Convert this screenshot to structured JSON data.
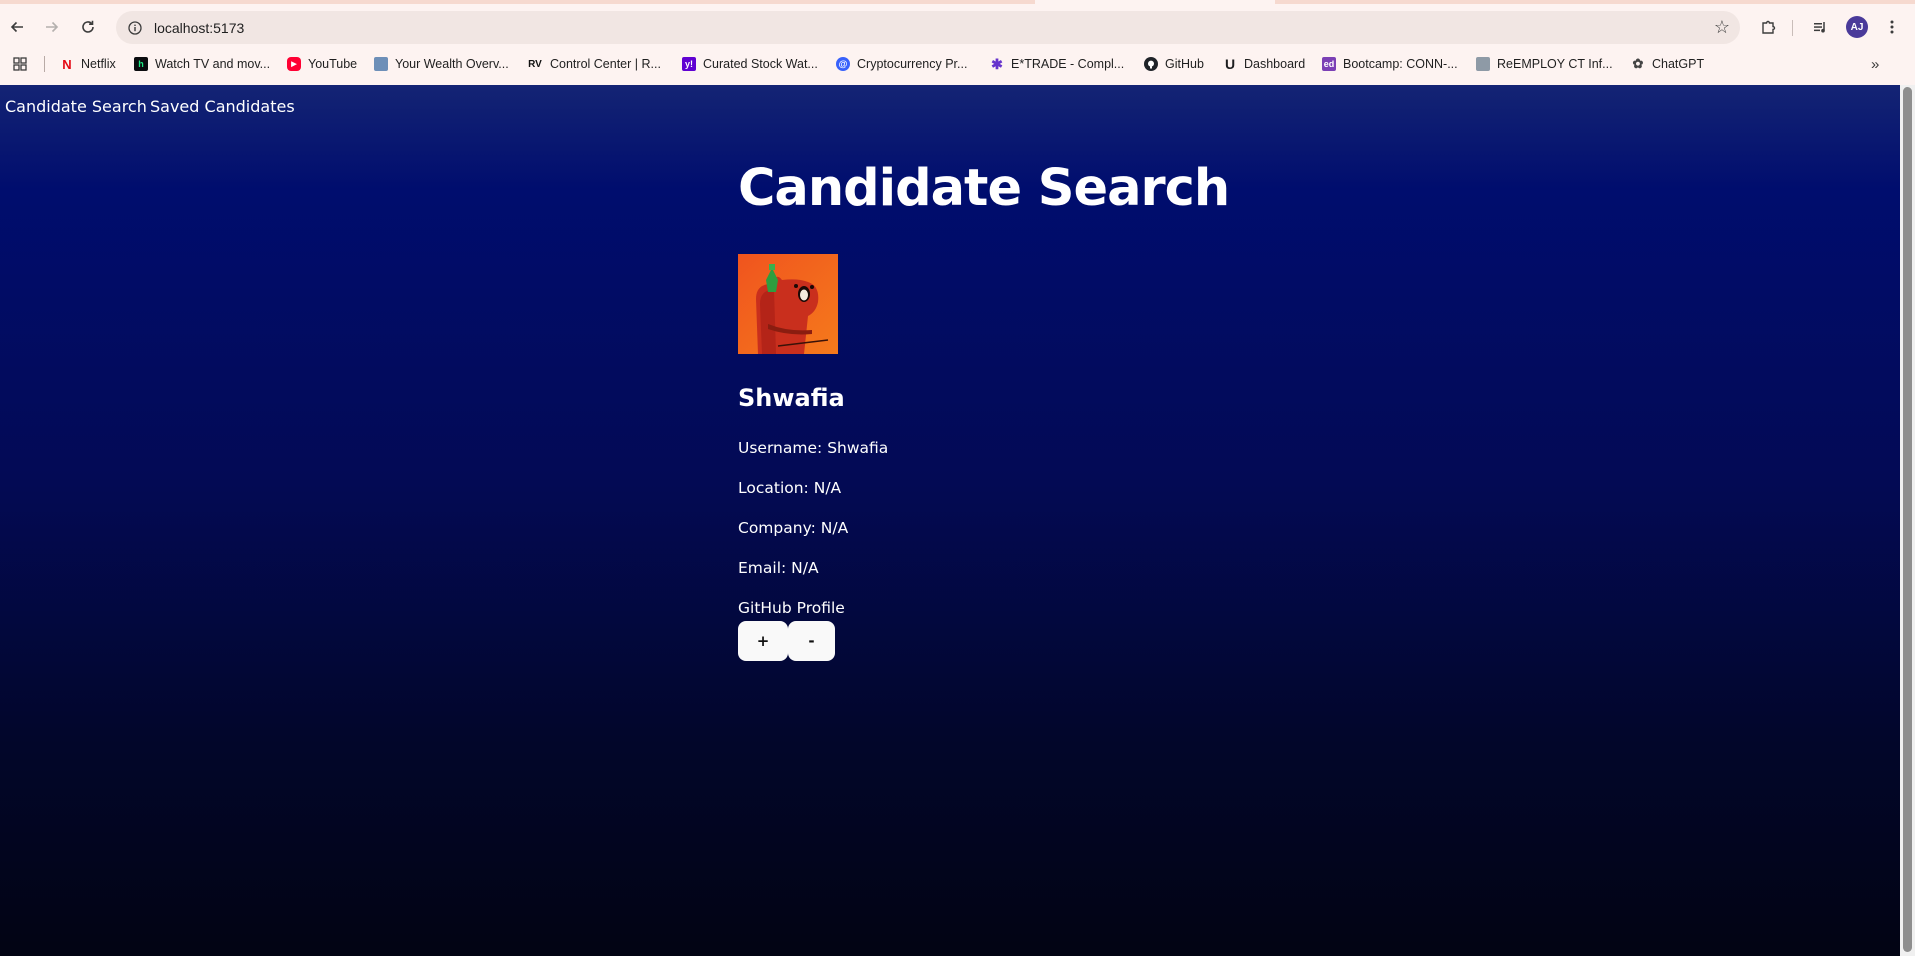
{
  "browser": {
    "url": "localhost:5173",
    "profile_initials": "AJ",
    "toolbar_icons": [
      "back-icon",
      "forward-icon",
      "reload-icon",
      "site-info-icon",
      "bookmark-star-icon",
      "extensions-icon",
      "media-controls-icon",
      "chrome-menu-icon"
    ],
    "bookmarks": [
      {
        "label": "Netflix",
        "icon": "netflix-icon",
        "color": "#e50914"
      },
      {
        "label": "Watch TV and mov...",
        "icon": "hulu-icon",
        "color": "#0b0c0f"
      },
      {
        "label": "YouTube",
        "icon": "youtube-icon",
        "color": "#ff0033"
      },
      {
        "label": "Your Wealth Overv...",
        "icon": "wealth-icon",
        "color": "#6d8fb8"
      },
      {
        "label": "Control Center | R...",
        "icon": "rv-icon",
        "color": "#111111"
      },
      {
        "label": "Curated Stock Wat...",
        "icon": "yahoo-icon",
        "color": "#6001d2"
      },
      {
        "label": "Cryptocurrency Pr...",
        "icon": "coinmarketcap-icon",
        "color": "#3861fb"
      },
      {
        "label": "E*TRADE - Compl...",
        "icon": "etrade-icon",
        "color": "#6633cc"
      },
      {
        "label": "GitHub",
        "icon": "github-icon",
        "color": "#1f2328"
      },
      {
        "label": "Dashboard",
        "icon": "udemy-icon",
        "color": "#1c1d1f"
      },
      {
        "label": "Bootcamp: CONN-...",
        "icon": "edx-icon",
        "color": "#7b3fb5"
      },
      {
        "label": "ReEMPLOY CT Inf...",
        "icon": "reemploy-icon",
        "color": "#8e9aa6"
      },
      {
        "label": "ChatGPT",
        "icon": "chatgpt-icon",
        "color": "#444444"
      }
    ]
  },
  "nav": {
    "candidate_search": "Candidate Search",
    "saved_candidates": "Saved Candidates"
  },
  "main": {
    "title": "Candidate Search",
    "candidate": {
      "name": "Shwafia",
      "avatar_icon": "sriracha-bear-avatar",
      "details": [
        {
          "label": "Username:",
          "value": "Shwafia"
        },
        {
          "label": "Location:",
          "value": "N/A"
        },
        {
          "label": "Company:",
          "value": "N/A"
        },
        {
          "label": "Email:",
          "value": "N/A"
        }
      ],
      "profile_link": "GitHub Profile"
    },
    "actions": {
      "accept": "+",
      "reject": "-"
    }
  },
  "colors": {
    "page_gradient_top": "#142474",
    "page_gradient_mid": "#000d6e",
    "page_gradient_bottom": "#020413",
    "button_bg": "#f9f9f9",
    "chrome_bg": "#fdf3f1"
  }
}
